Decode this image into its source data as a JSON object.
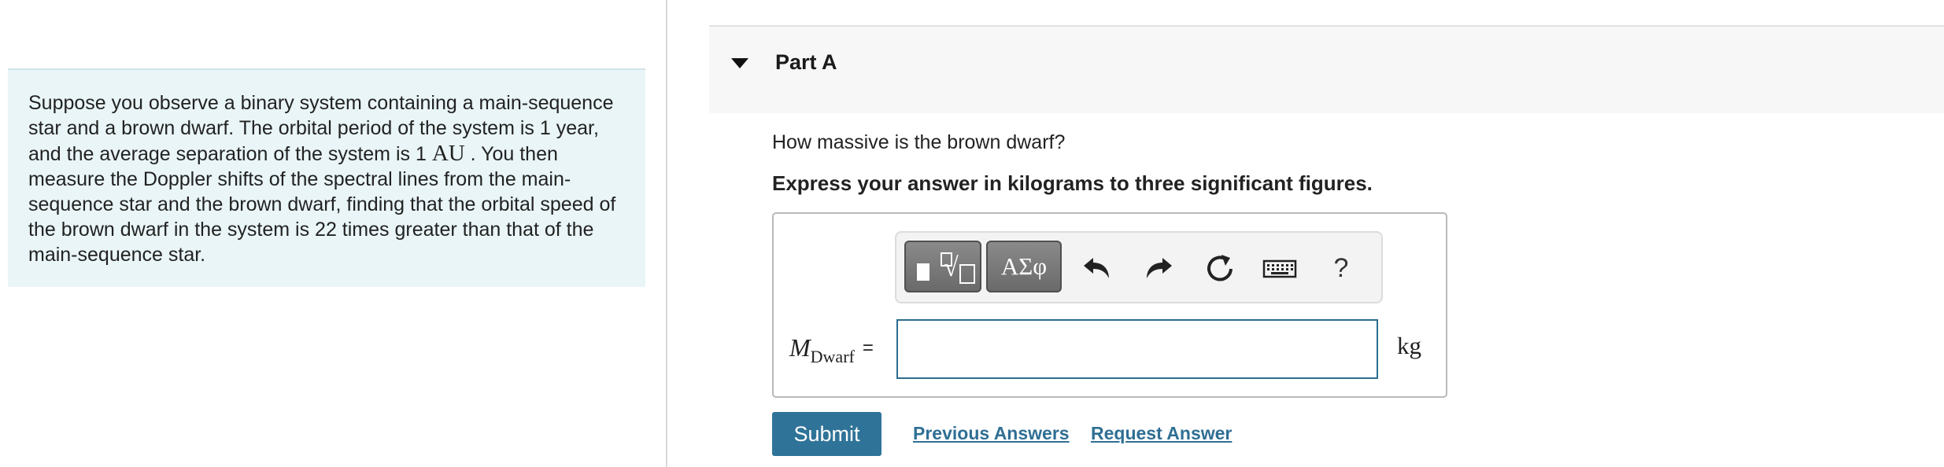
{
  "problem": {
    "text_before_unit": "Suppose you observe a binary system containing a main-sequence star and a brown dwarf. The orbital period of the system is 1 year, and the average separation of the system is 1",
    "unit_au": "AU",
    "text_after_unit": ". You then measure the Doppler shifts of the spectral lines from the main-sequence star and the brown dwarf, finding that the orbital speed of the brown dwarf in the system is 22 times greater than that of the main-sequence star."
  },
  "part": {
    "title": "Part A"
  },
  "question": {
    "text": "How massive is the brown dwarf?",
    "instruction": "Express your answer in kilograms to three significant figures."
  },
  "toolbar": {
    "greek_label": "ΑΣφ",
    "help_label": "?",
    "icons": [
      "templates-icon",
      "greek-letters-icon",
      "undo-icon",
      "redo-icon",
      "reset-icon",
      "keyboard-icon",
      "help-icon"
    ]
  },
  "answer": {
    "variable_symbol": "M",
    "variable_subscript": "Dwarf",
    "equals": "=",
    "value": "",
    "unit": "kg"
  },
  "actions": {
    "submit_label": "Submit",
    "previous_answers_label": "Previous Answers",
    "request_answer_label": "Request Answer"
  },
  "colors": {
    "submit_bg": "#2f7398",
    "link": "#2f6f94",
    "problem_bg": "#e9f5f7",
    "input_border": "#2a6d8e"
  }
}
